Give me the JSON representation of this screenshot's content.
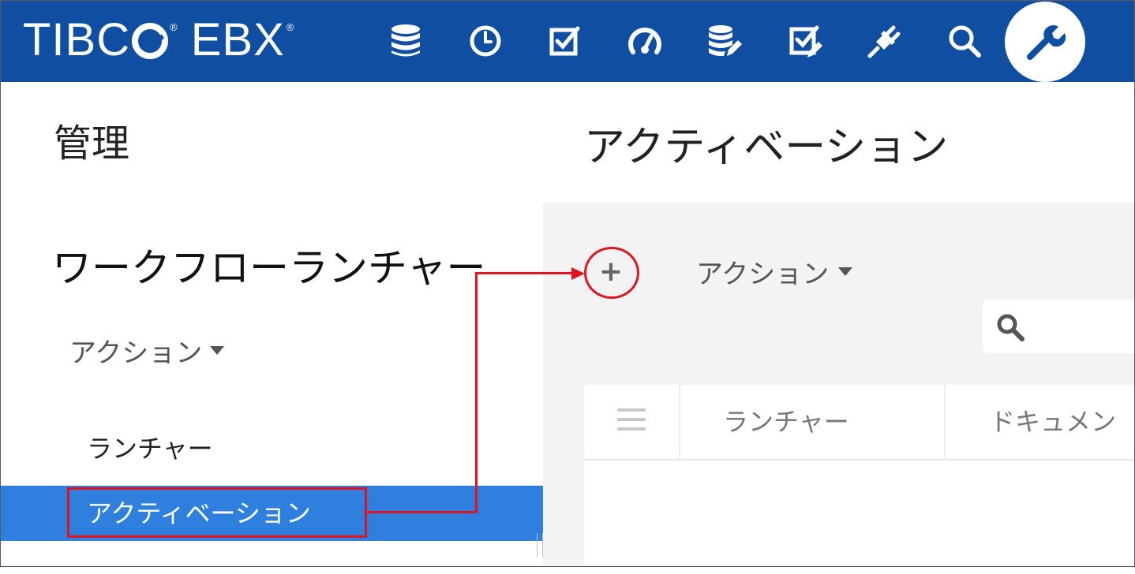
{
  "header": {
    "brand": {
      "part1": "TIBC",
      "part2": "EBX",
      "reg": "®"
    },
    "nav_icons": [
      "database-icon",
      "clock-icon",
      "checkbox-icon",
      "dashboard-gauge-icon",
      "data-edit-icon",
      "task-check-icon",
      "plug-icon",
      "search-icon"
    ],
    "active_icon": "wrench-icon",
    "colors": {
      "bar": "#0f4ea0",
      "icon": "#ffffff",
      "active_icon": "#0f4ea0"
    }
  },
  "sidebar": {
    "title": "管理",
    "section_title": "ワークフローランチャー",
    "action_label": "アクション",
    "items": [
      {
        "label": "ランチャー",
        "active": false
      },
      {
        "label": "アクティベーション",
        "active": true
      }
    ],
    "colors": {
      "active_bg": "#2f7fde"
    }
  },
  "main": {
    "title": "アクティベーション",
    "add_button": "+",
    "action_label": "アクション",
    "table": {
      "columns": [
        "ランチャー",
        "ドキュメン"
      ]
    }
  },
  "annotation": {
    "color": "#e0141e"
  }
}
